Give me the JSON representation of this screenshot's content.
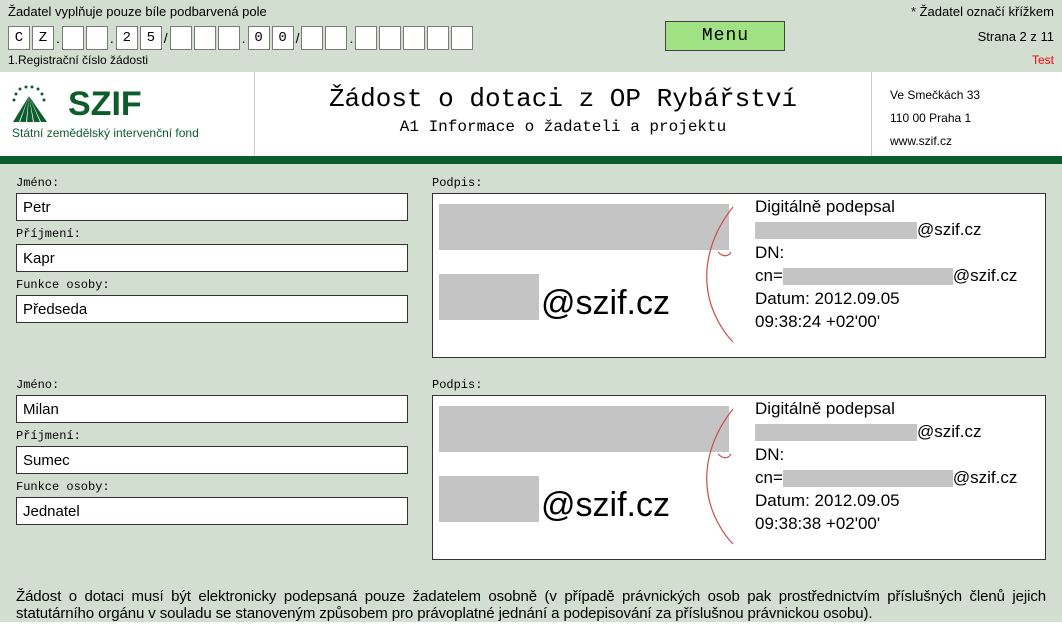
{
  "topbar": {
    "left_note": "Žadatel vyplňuje pouze bíle podbarvená pole",
    "right_note": "* Žadatel označí křížkem",
    "page_indicator": "Strana 2 z 11",
    "test_label": "Test",
    "reg_caption": "1.Registrační číslo žádosti",
    "menu_label": "Menu",
    "reg_cells": {
      "c1": "C",
      "c2": "Z",
      "dot1": ".",
      "c3": "",
      "c4": "",
      "dot2": ".",
      "c5": "2",
      "c6": "5",
      "slash": "/",
      "c7": "",
      "c8": "",
      "c9": "",
      "dot3": ".",
      "c10": "0",
      "c11": "0",
      "slash2": "/",
      "c12": "",
      "c13": "",
      "dot4": ".",
      "c14": "",
      "c15": "",
      "c16": "",
      "c17": "",
      "c18": ""
    }
  },
  "logo": {
    "name": "SZIF",
    "subtitle": "Státní zemědělský intervenční fond"
  },
  "title": {
    "main": "Žádost o dotaci z OP Rybářství",
    "sub": "A1 Informace o žadateli a projektu"
  },
  "address": {
    "line1": "Ve Smečkách 33",
    "line2": "110 00 Praha 1",
    "line3": "www.szif.cz"
  },
  "labels": {
    "jmeno": "Jméno:",
    "prijmeni": "Příjmení:",
    "funkce": "Funkce osoby:",
    "podpis": "Podpis:"
  },
  "persons": [
    {
      "first_name": "Petr",
      "last_name": "Kapr",
      "role": "Předseda",
      "signature": {
        "big_text": "@szif.cz",
        "signed_by_label": "Digitálně podepsal",
        "email_suffix": "@szif.cz",
        "dn_label": "DN:",
        "cn_prefix": "cn=",
        "dn_suffix": "@szif.cz",
        "datum_label": "Datum:",
        "datum": "2012.09.05",
        "time": "09:38:24 +02'00'"
      }
    },
    {
      "first_name": "Milan",
      "last_name": "Sumec",
      "role": "Jednatel",
      "signature": {
        "big_text": "@szif.cz",
        "signed_by_label": "Digitálně podepsal",
        "email_suffix": "@szif.cz",
        "dn_label": "DN:",
        "cn_prefix": "cn=",
        "dn_suffix": "@szif.cz",
        "datum_label": "Datum:",
        "datum": "2012.09.05",
        "time": "09:38:38 +02'00'"
      }
    }
  ],
  "footer": "Žádost o dotaci musí být elektronicky podepsaná pouze žadatelem osobně (v případě právnických osob pak prostřednictvím příslušných členů jejich statutárního orgánu v souladu se stanoveným způsobem pro právoplatné jednání a podepisování za příslušnou právnickou osobu)."
}
